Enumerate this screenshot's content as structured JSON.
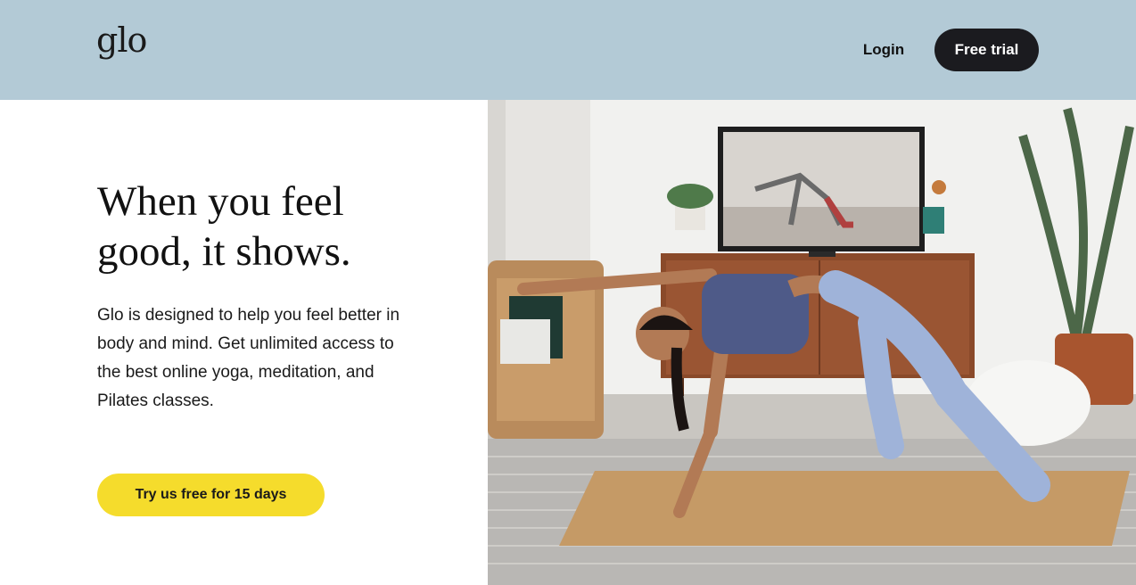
{
  "header": {
    "logo_text": "glo",
    "login_label": "Login",
    "free_trial_label": "Free trial",
    "background_color": "#b3cad6"
  },
  "hero": {
    "headline_line1": "When you feel",
    "headline_line2": "good, it shows.",
    "description": "Glo is designed to help you feel better in body and mind. Get unlimited access to the best online yoga, meditation, and Pilates classes.",
    "cta_label": "Try us free for 15 days",
    "cta_color": "#f5dc2c"
  }
}
